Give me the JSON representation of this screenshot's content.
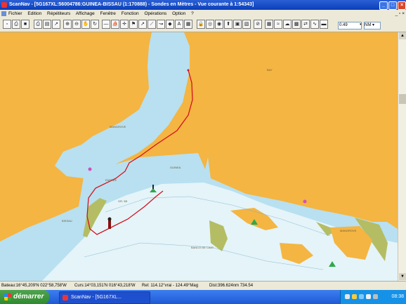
{
  "window": {
    "title": "ScanNav - [5G167XL:56004786:GUINEA-BISSAU (1:170888) - Sondes en  Mètres  - Vue courante à 1:54343]",
    "controls": [
      "_",
      "□",
      "×"
    ]
  },
  "menubar": {
    "items": [
      "Fichier",
      "Edition",
      "Répétiteurs",
      "Affichage",
      "Fenêtre",
      "Fonction",
      "Opérations",
      "Option",
      "?"
    ],
    "right_controls": "_ ▫ ×"
  },
  "toolbar": {
    "scale_value": "0.49",
    "unit_value": "NM"
  },
  "map": {
    "labels": [
      "BAY",
      "MANGROVE",
      "GUINEA",
      "GR. 5B",
      "BISSAU",
      "ENTREE",
      "BANCO DE CAIO",
      "MANGROVE"
    ]
  },
  "statusbar": {
    "position": "Bateau:16°45,209'N 022°58,758'W",
    "course": "Curs:14°03,151'N 016°43,218'W",
    "bearing": "Rel: 114.12°vrai - 124.49°Mag",
    "distance": "Dist:396.624nm  734.54"
  },
  "taskbar": {
    "start_label": "démarrer",
    "task_label": "ScanNav - [5G167XL...",
    "clock": "08:38"
  },
  "colors": {
    "land": "#f4b542",
    "shallow_water": "#b8e0f0",
    "deep_water": "#e4f4f9",
    "mud": "#b4bd64",
    "route": "#d4121e"
  }
}
